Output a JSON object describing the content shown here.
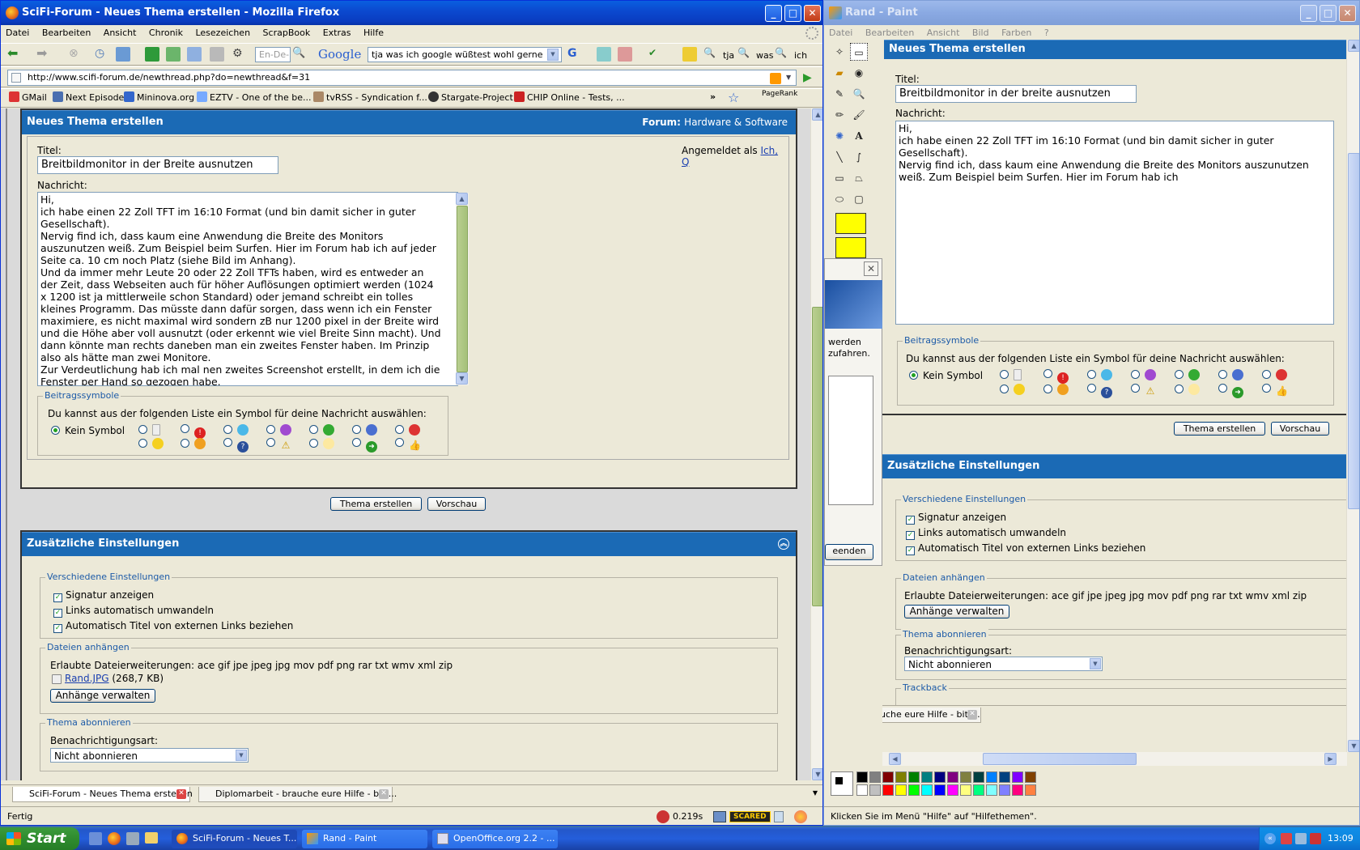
{
  "firefox": {
    "title": "SciFi-Forum - Neues Thema erstellen - Mozilla Firefox",
    "menu": [
      "Datei",
      "Bearbeiten",
      "Ansicht",
      "Chronik",
      "Lesezeichen",
      "ScrapBook",
      "Extras",
      "Hilfe"
    ],
    "translate_placeholder": "En-De-E",
    "google_label": "Google",
    "google_search_value": "tja was ich google wüßtest wohl gerne",
    "toolbar_words": [
      "tja",
      "was",
      "ich"
    ],
    "url": "http://www.scifi-forum.de/newthread.php?do=newthread&f=31",
    "bookmarks": [
      "GMail",
      "Next Episode",
      "Mininova.org",
      "EZTV - One of the be...",
      "tvRSS - Syndication f...",
      "Stargate-Project",
      "CHIP Online - Tests, ..."
    ],
    "bookmarks_more": "»",
    "pagerank_label": "PageRank",
    "tabs": [
      {
        "label": "SciFi-Forum - Neues Thema erstellen",
        "active": true
      },
      {
        "label": "Diplomarbeit - brauche eure Hilfe - bitt...",
        "active": false
      }
    ],
    "status": "Fertig",
    "status_time": "0.219s",
    "status_badge": "SCARED"
  },
  "forum": {
    "header_title": "Neues Thema erstellen",
    "forum_label": "Forum:",
    "forum_name": "Hardware & Software",
    "logged_in_label": "Angemeldet als",
    "logged_in_user": "Ich, Q",
    "title_label": "Titel:",
    "title_value": "Breitbildmonitor in der Breite ausnutzen",
    "message_label": "Nachricht:",
    "message_text": "Hi,\nich habe einen 22 Zoll TFT im 16:10 Format (und bin damit sicher in guter Gesellschaft).\nNervig find ich, dass kaum eine Anwendung die Breite des Monitors auszunutzen weiß. Zum Beispiel beim Surfen. Hier im Forum hab ich auf jeder Seite ca. 10 cm noch Platz (siehe Bild im Anhang).\nUnd da immer mehr Leute 20 oder 22 Zoll TFTs haben, wird es entweder an der Zeit, dass Webseiten auch für höher Auflösungen optimiert werden (1024 x 1200 ist ja mittlerweile schon Standard) oder jemand schreibt ein tolles kleines Programm. Das müsste dann dafür sorgen, dass wenn ich ein Fenster maximiere, es nicht maximal wird sondern zB nur 1200 pixel in der Breite wird und die Höhe aber voll ausnutzt (oder erkennt wie viel Breite Sinn macht). Und dann könnte man rechts daneben man ein zweites Fenster haben. Im Prinzip also als hätte man zwei Monitore.\nZur Verdeutlichung hab ich mal nen zweites Screenshot erstellt, in dem ich die Fenster per Hand so gezogen habe.",
    "symbols_legend": "Beitragssymbole",
    "symbols_prompt": "Du kannst aus der folgenden Liste ein Symbol für deine Nachricht auswählen:",
    "no_symbol": "Kein Symbol",
    "submit_label": "Thema erstellen",
    "preview_label": "Vorschau",
    "extra_title": "Zusätzliche Einstellungen",
    "misc_legend": "Verschiedene Einstellungen",
    "options": [
      "Signatur anzeigen",
      "Links automatisch umwandeln",
      "Automatisch Titel von externen Links beziehen"
    ],
    "attach_legend": "Dateien anhängen",
    "attach_allowed": "Erlaubte Dateierweiterungen: ace gif jpe jpeg jpg mov pdf png rar txt wmv xml zip",
    "attach_file": "Rand.JPG",
    "attach_size": "(268,7 KB)",
    "attach_button": "Anhänge verwalten",
    "subscribe_legend": "Thema abonnieren",
    "notify_label": "Benachrichtigungsart:",
    "notify_value": "Nicht abonnieren",
    "trackback_legend": "Trackback"
  },
  "paint": {
    "title": "Rand - Paint",
    "menu": [
      "Datei",
      "Bearbeiten",
      "Ansicht",
      "Bild",
      "Farben",
      "?"
    ],
    "message_text": "Hi,\nich habe einen 22 Zoll TFT im 16:10 Format (und bin damit sicher in guter Gesellschaft).\nNervig find ich, dass kaum eine Anwendung die Breite des Monitors auszunutzen weiß. Zum Beispiel beim Surfen. Hier im Forum hab ich",
    "title_value": "Breitbildmonitor in der breite ausnutzen",
    "status": "Klicken Sie im Menü \"Hilfe\" auf \"Hilfethemen\".",
    "inner_tab": "uche eure Hilfe - bitt...",
    "bg_window_text1": "werden",
    "bg_window_text2": "zufahren.",
    "bg_window_button": "eenden",
    "palette": [
      "#000000",
      "#808080",
      "#800000",
      "#808000",
      "#008000",
      "#008080",
      "#000080",
      "#800080",
      "#808040",
      "#004040",
      "#0080ff",
      "#004080",
      "#8000ff",
      "#804000",
      "#ffffff",
      "#c0c0c0",
      "#ff0000",
      "#ffff00",
      "#00ff00",
      "#00ffff",
      "#0000ff",
      "#ff00ff",
      "#ffff80",
      "#00ff80",
      "#80ffff",
      "#8080ff",
      "#ff0080",
      "#ff8040"
    ]
  },
  "taskbar": {
    "start": "Start",
    "items": [
      "SciFi-Forum - Neues T...",
      "Rand - Paint",
      "OpenOffice.org 2.2 - ..."
    ],
    "clock": "13:09"
  }
}
